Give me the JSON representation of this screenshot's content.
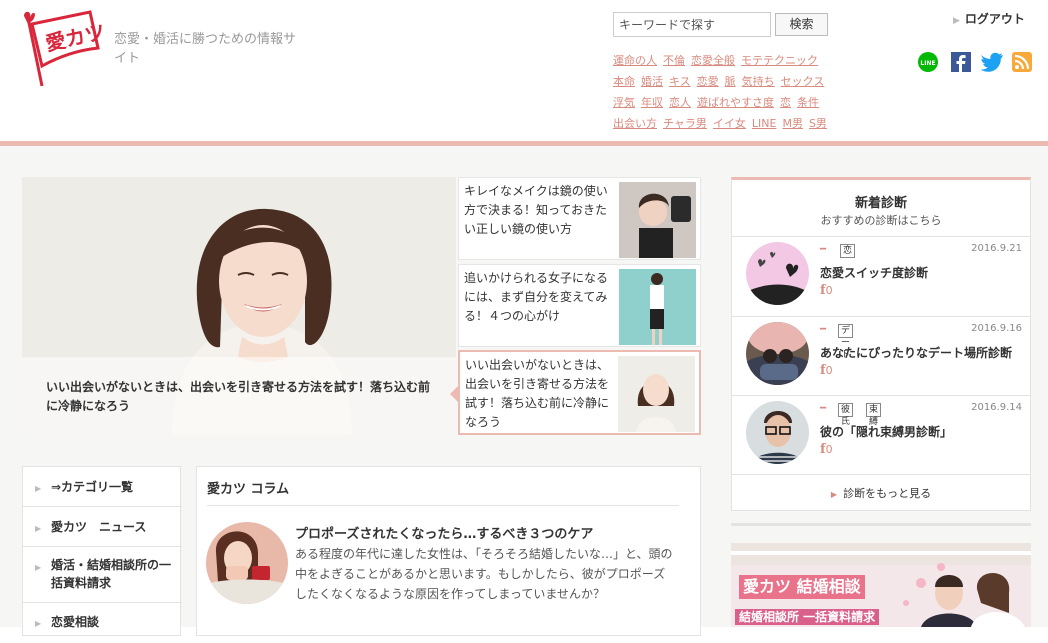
{
  "header": {
    "logo_text": "愛カツ",
    "tagline": "恋愛・婚活に勝つための情報サイト",
    "search": {
      "value": "キーワードで探す",
      "button": "検索"
    },
    "logout": "ログアウト",
    "tags": [
      [
        "運命の人",
        "不倫",
        "恋愛全般",
        "モテテクニック"
      ],
      [
        "本命",
        "婚活",
        "キス",
        "恋愛",
        "脈",
        "気持ち",
        "セックス"
      ],
      [
        "浮気",
        "年収",
        "恋人",
        "遊ばれやすさ度",
        "恋",
        "条件"
      ],
      [
        "出会い方",
        "チャラ男",
        "イイ女",
        "LINE",
        "M男",
        "S男"
      ]
    ]
  },
  "hero": {
    "caption": "いい出会いがないときは、出会いを引き寄せる方法を試す！落ち込む前に冷静になろう"
  },
  "side_articles": [
    {
      "title": "キレイなメイクは鏡の使い方で決まる！知っておきたい正しい鏡の使い方"
    },
    {
      "title": "追いかけられる女子になるには、まず自分を変えてみる！４つの心がけ"
    },
    {
      "title": "いい出会いがないときは、出会いを引き寄せる方法を試す！落ち込む前に冷静になろう"
    }
  ],
  "categories": [
    {
      "label": "⇒カテゴリ一覧"
    },
    {
      "label": "愛カツ　ニュース"
    },
    {
      "label": "婚活・結婚相談所の一括資料請求"
    },
    {
      "label": "恋愛相談"
    }
  ],
  "column": {
    "title": "愛カツ コラム",
    "article": {
      "title": "プロポーズされたくなったら…するべき３つのケア",
      "body": "ある程度の年代に達した女性は、「そろそろ結婚したいな…」と、頭の中をよぎることがあるかと思います。もしかしたら、彼がプロポーズしたくなくなるような原因を作ってしまっていませんか？"
    }
  },
  "diagnosis": {
    "title": "新着診断",
    "subtitle": "おすすめの診断はこちら",
    "items": [
      {
        "tags": [
          "恋"
        ],
        "date": "2016.9.21",
        "title": "恋愛スイッチ度診断",
        "count": "0"
      },
      {
        "tags": [
          "デート"
        ],
        "date": "2016.9.16",
        "title": "あなたにぴったりなデート場所診断",
        "count": "0"
      },
      {
        "tags": [
          "彼氏",
          "束縛"
        ],
        "date": "2016.9.14",
        "title": "彼の「隠れ束縛男診断」",
        "count": "0"
      }
    ],
    "more": "診断をもっと見る"
  },
  "banner": {
    "title": "愛カツ 結婚相談",
    "subtitle": "結婚相談所 一括資料請求"
  },
  "colors": {
    "accent": "#ecbab0",
    "link": "#d98a7e",
    "logo_red": "#d9263a"
  }
}
